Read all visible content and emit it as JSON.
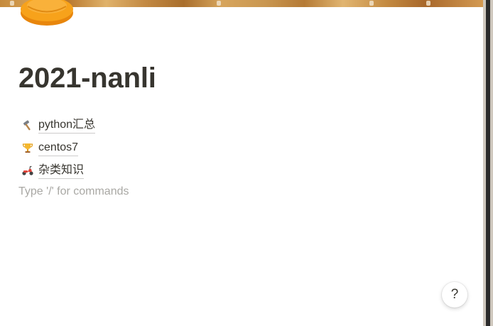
{
  "page": {
    "title": "2021-nanli",
    "icon": "orange-disc-icon",
    "cover": "painting-cover"
  },
  "links": [
    {
      "icon": "hammer-icon",
      "label": "python汇总"
    },
    {
      "icon": "trophy-icon",
      "label": "centos7"
    },
    {
      "icon": "scooter-icon",
      "label": "杂类知识"
    }
  ],
  "editor": {
    "placeholder": "Type '/' for commands"
  },
  "help": {
    "label": "?"
  },
  "colors": {
    "text": "#37352f",
    "placeholder": "#a9a8a4",
    "icon_orange": "#f7a21b"
  }
}
